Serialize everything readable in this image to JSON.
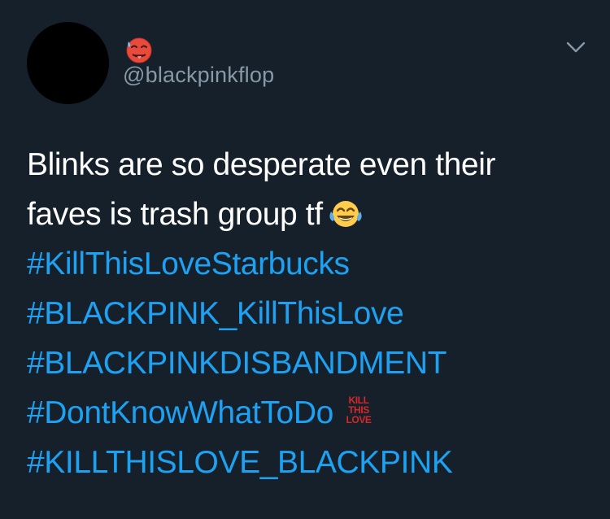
{
  "tweet": {
    "handle": "@blackpinkflop",
    "name_emoji_icon": "hot-face-emoji-icon",
    "menu_icon": "chevron-down-icon",
    "text_line_1": "Blinks are so desperate even their",
    "text_line_2": "faves is trash group tf",
    "laughing_emoji_icon": "face-with-tears-of-joy-icon",
    "hashtags": [
      "#KillThisLoveStarbucks",
      "#BLACKPINK_KillThisLove",
      "#BLACKPINKDISBANDMENT",
      "#DontKnowWhatToDo",
      "#KILLTHISLOVE_BLACKPINK"
    ],
    "badge": {
      "line1": "KILL",
      "line2": "THIS",
      "line3": "LOVE",
      "color": "#d62828"
    }
  },
  "colors": {
    "background": "#15202b",
    "text": "#ffffff",
    "secondary_text": "#8899a6",
    "link": "#1da1f2"
  }
}
